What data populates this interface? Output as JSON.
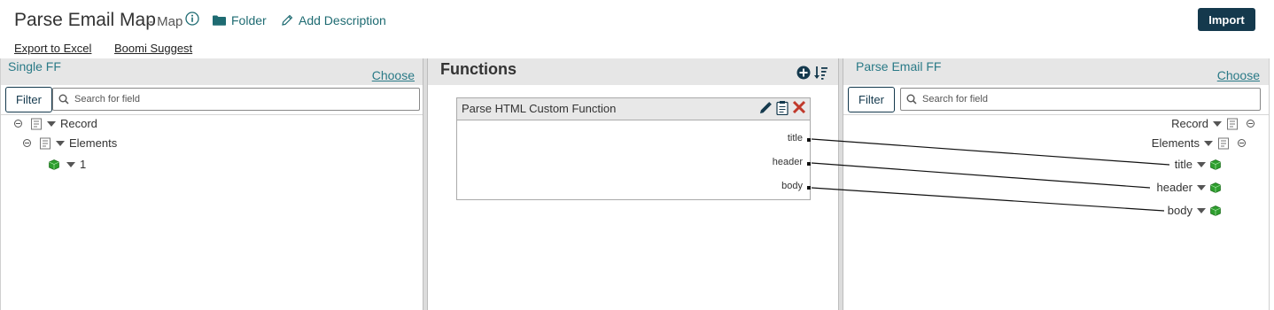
{
  "header": {
    "title": "Parse Email Map",
    "subtitle": "- Map",
    "folder_label": "Folder",
    "add_description_label": "Add Description",
    "import_label": "Import",
    "export_label": "Export to Excel",
    "suggest_label": "Boomi Suggest"
  },
  "source": {
    "title": "Single FF",
    "choose_label": "Choose",
    "filter_label": "Filter",
    "search_placeholder": "Search for field",
    "tree": [
      {
        "label": "Record"
      },
      {
        "label": "Elements"
      },
      {
        "label": "1"
      }
    ]
  },
  "functions": {
    "title": "Functions",
    "function_name": "Parse HTML Custom Function",
    "outputs": [
      "title",
      "header",
      "body"
    ]
  },
  "destination": {
    "title": "Parse Email FF",
    "choose_label": "Choose",
    "filter_label": "Filter",
    "search_placeholder": "Search for field",
    "tree": [
      {
        "label": "Record"
      },
      {
        "label": "Elements"
      },
      {
        "label": "title"
      },
      {
        "label": "header"
      },
      {
        "label": "body"
      }
    ]
  },
  "mappings": [
    {
      "from": "title",
      "to": "title"
    },
    {
      "from": "header",
      "to": "header"
    },
    {
      "from": "body",
      "to": "body"
    }
  ],
  "colors": {
    "accent": "#2a7a87",
    "import_button": "#14394d",
    "delete": "#c0392b",
    "element_green": "#2e9e2e"
  }
}
